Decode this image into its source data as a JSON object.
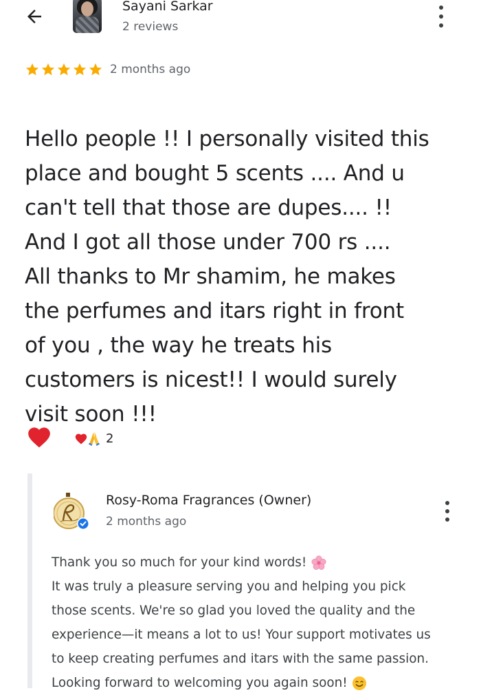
{
  "reviewer": {
    "name": "Sayani Sarkar",
    "meta": "2 reviews"
  },
  "review": {
    "rating": 5,
    "time": "2 months ago",
    "lines": [
      "Hello people !! I personally visited this",
      "place and bought 5 scents .... And u",
      "can't tell that those are dupes.... !!",
      "And I got  all those under 700 rs ....",
      "All thanks to Mr shamim, he makes",
      "the perfumes and itars right in front",
      "of you , the way he treats his",
      "customers is nicest!! I would surely",
      "visit soon !!!"
    ]
  },
  "reactions": {
    "count": "2",
    "icons": [
      "heart-icon",
      "pray-icon"
    ]
  },
  "owner_reply": {
    "name": "Rosy-Roma Fragrances (Owner)",
    "time": "2 months ago",
    "lines": [
      "Thank you so much for your kind words! ",
      "It was truly a pleasure serving you and helping you pick",
      "those scents. We're so glad you loved the quality and the",
      "experience—it means a lot to us! Your support motivates us",
      "to keep creating perfumes and itars with the same passion.",
      "Looking forward to welcoming you again soon! "
    ]
  },
  "colors": {
    "star": "#f9ab00",
    "heart": "#e1232d",
    "verified": "#1a73e8",
    "text_primary": "#202124",
    "text_secondary": "#5f6368",
    "reply_bar": "#e8eaed"
  }
}
